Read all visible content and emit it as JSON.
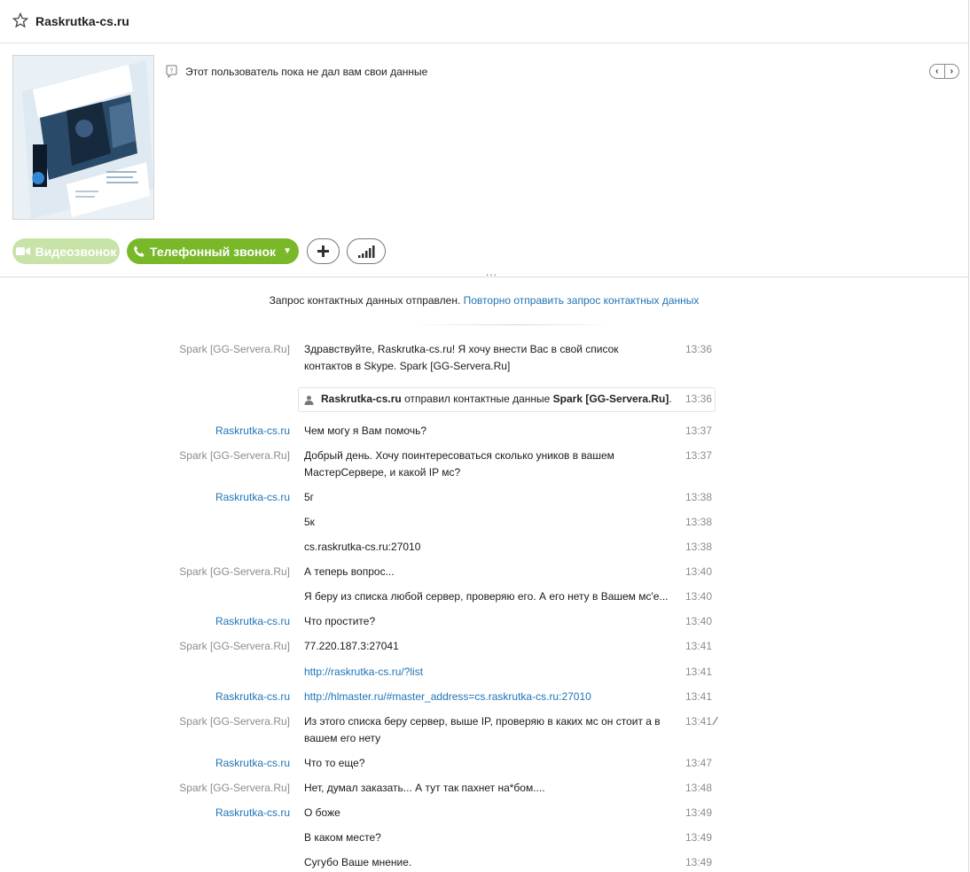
{
  "window": {
    "title": "Raskrutka-cs.ru"
  },
  "profile": {
    "mood": "Этот пользователь пока не дал вам свои данные",
    "avatar_icon": "website-screenshot-avatar"
  },
  "actions": {
    "video_label": "Видеозвонок",
    "call_label": "Телефонный звонок",
    "more": "..."
  },
  "notice": {
    "text": "Запрос контактных данных отправлен.",
    "link": "Повторно отправить запрос контактных данных"
  },
  "contact_event": {
    "from": "Raskrutka-cs.ru",
    "middle": "отправил контактные данные",
    "contact": "Spark [GG-Servera.Ru]",
    "end": ".",
    "time": "13:36"
  },
  "messages": [
    {
      "sender": "Spark [GG-Servera.Ru]",
      "text": "Здравствуйте, Raskrutka-cs.ru! Я хочу внести Вас в свой список контактов в Skype. Spark [GG-Servera.Ru]",
      "time": "13:36"
    },
    {
      "sender": "Raskrutka-cs.ru",
      "text": "Чем могу я Вам помочь?",
      "time": "13:37"
    },
    {
      "sender": "Spark [GG-Servera.Ru]",
      "text": "Добрый день. Хочу поинтересоваться сколько уников в вашем МастерСервере, и какой IP мс?",
      "time": "13:37"
    },
    {
      "sender": "Raskrutka-cs.ru",
      "text": "5г",
      "time": "13:38"
    },
    {
      "sender": "",
      "text": "5к",
      "time": "13:38"
    },
    {
      "sender": "",
      "text": "cs.raskrutka-cs.ru:27010",
      "time": "13:38"
    },
    {
      "sender": "Spark [GG-Servera.Ru]",
      "text": "А теперь вопрос...",
      "time": "13:40"
    },
    {
      "sender": "",
      "text": "Я беру из списка любой сервер, проверяю его. А его нету в Вашем мс'е...",
      "time": "13:40"
    },
    {
      "sender": "Raskrutka-cs.ru",
      "text": "Что простите?",
      "time": "13:40"
    },
    {
      "sender": "Spark [GG-Servera.Ru]",
      "text": "77.220.187.3:27041",
      "time": "13:41"
    },
    {
      "sender": "",
      "text": "http://raskrutka-cs.ru/?list",
      "time": "13:41"
    },
    {
      "sender": "Raskrutka-cs.ru",
      "text": "http://hlmaster.ru/#master_address=cs.raskrutka-cs.ru:27010",
      "time": "13:41"
    },
    {
      "sender": "Spark [GG-Servera.Ru]",
      "text": "Из этого списка беру сервер, выше IP, проверяю в каких мс он стоит а в вашем его нету",
      "time": "13:41"
    },
    {
      "sender": "Raskrutka-cs.ru",
      "text": "Что то еще?",
      "time": "13:47"
    },
    {
      "sender": "Spark [GG-Servera.Ru]",
      "text": "Нет, думал заказать... А тут так пахнет на*бом....",
      "time": "13:48"
    },
    {
      "sender": "Raskrutka-cs.ru",
      "text": "О боже",
      "time": "13:49"
    },
    {
      "sender": "",
      "text": "В каком месте?",
      "time": "13:49"
    },
    {
      "sender": "",
      "text": "Сугубо Ваше мнение.",
      "time": "13:49"
    }
  ],
  "colors": {
    "link": "#1f74b7",
    "call_green": "#79b829",
    "video_disabled": "#c8e3a7"
  }
}
